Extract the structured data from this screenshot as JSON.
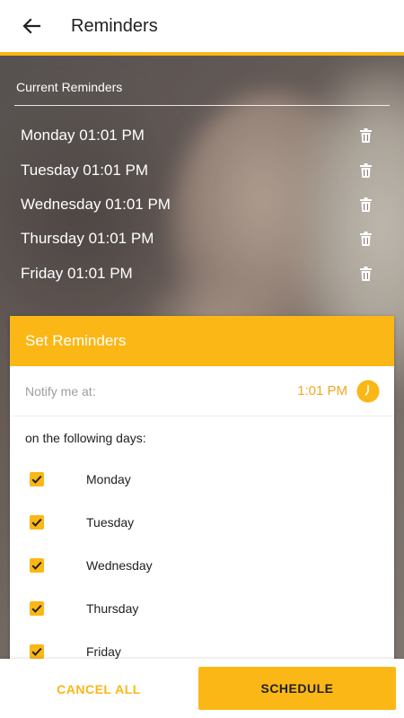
{
  "appbar": {
    "title": "Reminders",
    "back_icon": "arrow-left-icon"
  },
  "colors": {
    "accent": "#FBB715",
    "time_text": "#F5A623",
    "title_text": "#212121"
  },
  "current": {
    "label": "Current Reminders",
    "items": [
      {
        "label": "Monday 01:01 PM"
      },
      {
        "label": "Tuesday 01:01 PM"
      },
      {
        "label": "Wednesday 01:01 PM"
      },
      {
        "label": "Thursday 01:01 PM"
      },
      {
        "label": "Friday 01:01 PM"
      }
    ],
    "delete_icon": "trash-icon"
  },
  "set": {
    "title": "Set Reminders",
    "notify_label": "Notify me at:",
    "notify_time": "1:01 PM",
    "clock_icon": "clock-icon",
    "days_label": "on the following days:",
    "days": [
      {
        "label": "Monday",
        "checked": true
      },
      {
        "label": "Tuesday",
        "checked": true
      },
      {
        "label": "Wednesday",
        "checked": true
      },
      {
        "label": "Thursday",
        "checked": true
      },
      {
        "label": "Friday",
        "checked": true
      }
    ]
  },
  "actions": {
    "cancel_label": "CANCEL ALL",
    "schedule_label": "SCHEDULE"
  }
}
